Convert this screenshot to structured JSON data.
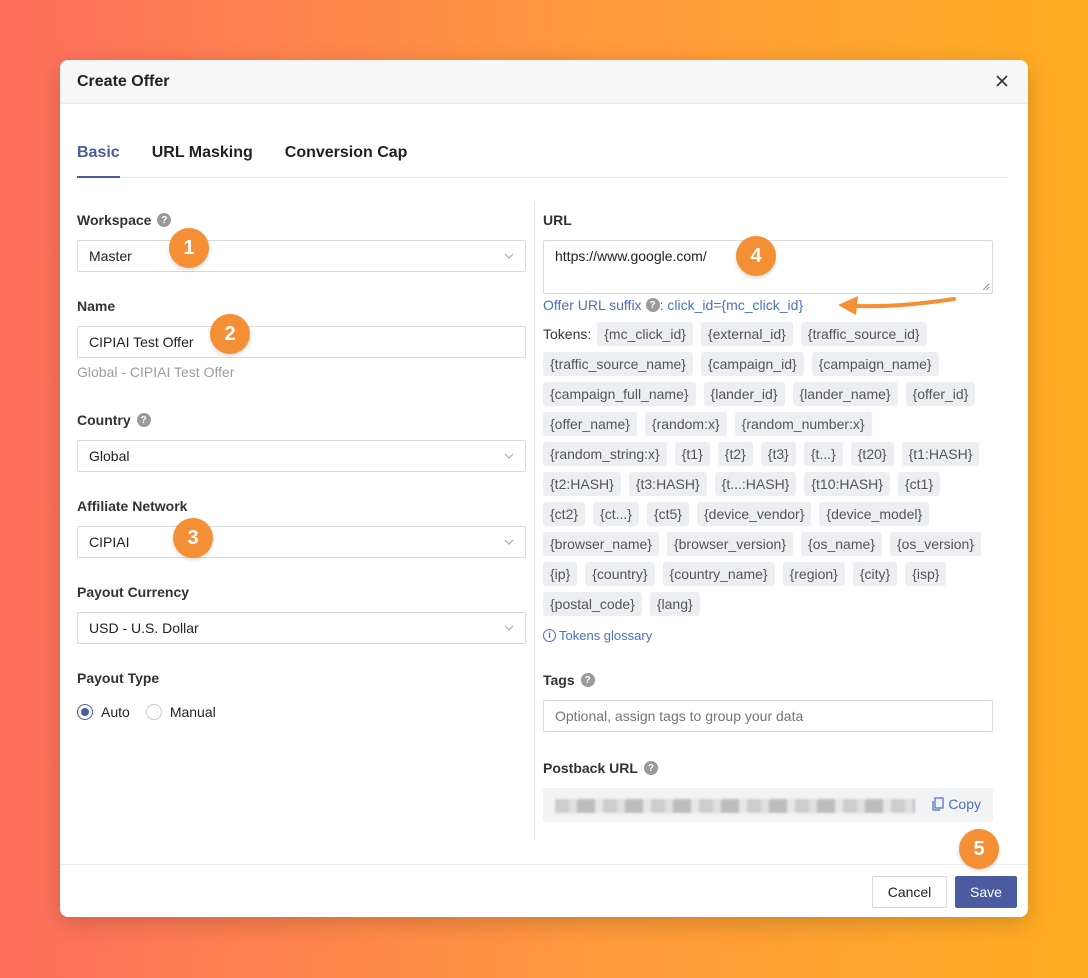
{
  "modal": {
    "title": "Create Offer"
  },
  "tabs": [
    {
      "label": "Basic",
      "active": true
    },
    {
      "label": "URL Masking",
      "active": false
    },
    {
      "label": "Conversion Cap",
      "active": false
    }
  ],
  "workspace": {
    "label": "Workspace",
    "value": "Master"
  },
  "name": {
    "label": "Name",
    "value": "CIPIAI Test Offer",
    "hint": "Global - CIPIAI Test Offer"
  },
  "country": {
    "label": "Country",
    "value": "Global"
  },
  "affiliate_network": {
    "label": "Affiliate Network",
    "value": "CIPIAI"
  },
  "payout_currency": {
    "label": "Payout Currency",
    "value": "USD - U.S. Dollar"
  },
  "payout_type": {
    "label": "Payout Type",
    "options": [
      "Auto",
      "Manual"
    ],
    "selected": "Auto"
  },
  "url": {
    "label": "URL",
    "value": "https://www.google.com/"
  },
  "suffix": {
    "label": "Offer URL suffix",
    "value": ": click_id={mc_click_id}"
  },
  "tokens": {
    "label": "Tokens:",
    "items": [
      "{mc_click_id}",
      "{external_id}",
      "{traffic_source_id}",
      "{traffic_source_name}",
      "{campaign_id}",
      "{campaign_name}",
      "{campaign_full_name}",
      "{lander_id}",
      "{lander_name}",
      "{offer_id}",
      "{offer_name}",
      "{random:x}",
      "{random_number:x}",
      "{random_string:x}",
      "{t1}",
      "{t2}",
      "{t3}",
      "{t...}",
      "{t20}",
      "{t1:HASH}",
      "{t2:HASH}",
      "{t3:HASH}",
      "{t...:HASH}",
      "{t10:HASH}",
      "{ct1}",
      "{ct2}",
      "{ct...}",
      "{ct5}",
      "{device_vendor}",
      "{device_model}",
      "{browser_name}",
      "{browser_version}",
      "{os_name}",
      "{os_version}",
      "{ip}",
      "{country}",
      "{country_name}",
      "{region}",
      "{city}",
      "{isp}",
      "{postal_code}",
      "{lang}"
    ],
    "glossary": "Tokens glossary"
  },
  "tags": {
    "label": "Tags",
    "placeholder": "Optional, assign tags to group your data"
  },
  "postback": {
    "label": "Postback URL",
    "copy_label": "Copy"
  },
  "footer": {
    "cancel_label": "Cancel",
    "save_label": "Save"
  },
  "badges": [
    "1",
    "2",
    "3",
    "4",
    "5"
  ],
  "colors": {
    "accent": "#4a5ba1",
    "link": "#4a6fc4",
    "badge": "#f58f35",
    "arrow": "#f58f35"
  }
}
